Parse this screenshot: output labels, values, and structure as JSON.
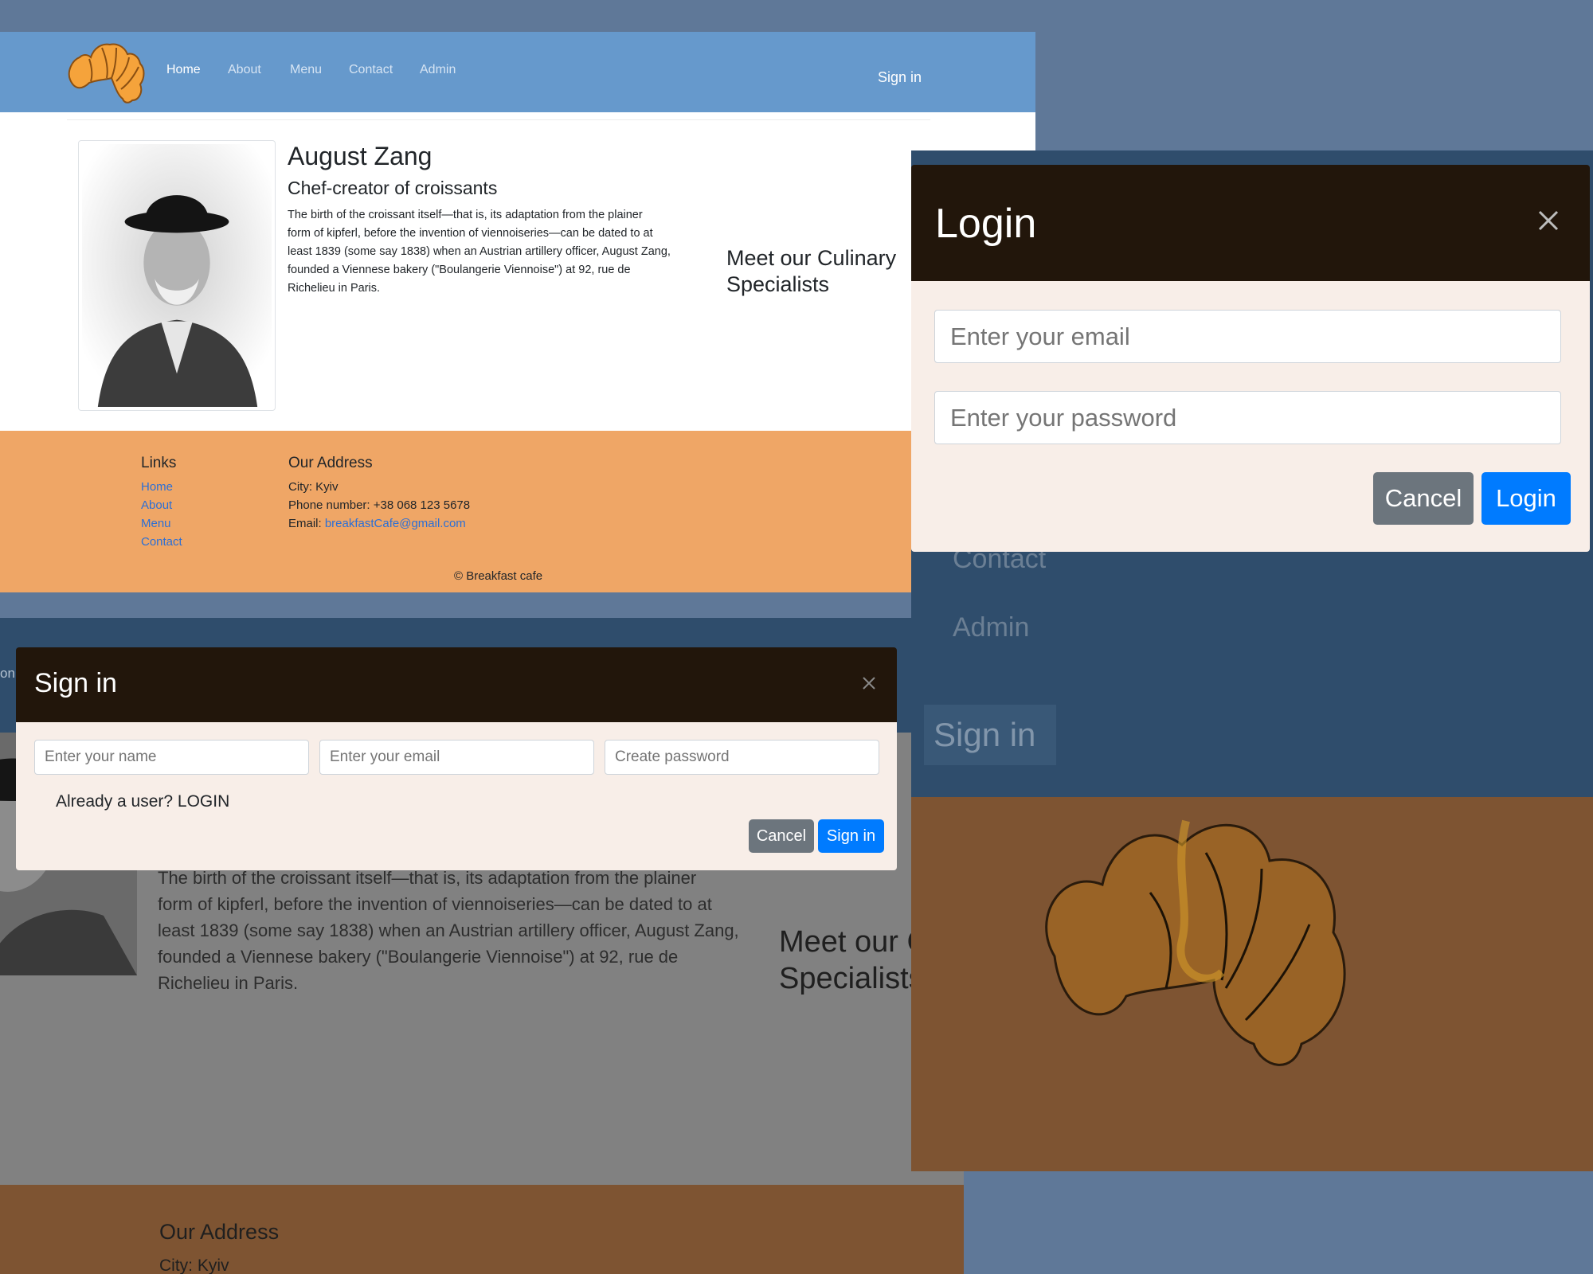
{
  "site": {
    "nav": {
      "logo_icon": "croissant-logo-icon",
      "links": [
        "Home",
        "About",
        "Menu",
        "Contact",
        "Admin"
      ],
      "active": "Home",
      "signin": "Sign in"
    },
    "chef": {
      "name": "August Zang",
      "role": "Chef-creator of croissants",
      "bio_lines": [
        "The birth of the croissant itself—that is, its adaptation from the plainer",
        "form of kipferl, before the invention of viennoiseries—can be dated to at",
        "least 1839 (some say 1838) when an Austrian artillery officer, August Zang,",
        "founded a Viennese bakery (\"Boulangerie Viennoise\") at 92, rue de",
        "Richelieu in Paris."
      ]
    },
    "specialists_lines": [
      "Meet our Culinary",
      "Specialists"
    ],
    "footer": {
      "links_heading": "Links",
      "links": [
        "Home",
        "About",
        "Menu",
        "Contact"
      ],
      "address_heading": "Our Address",
      "city": "City: Kyiv",
      "phone": "Phone number: +38 068 123 5678",
      "email_label": "Email: ",
      "email": "breakfastCafe@gmail.com",
      "copyright": "© Breakfast cafe"
    }
  },
  "signin_modal": {
    "title": "Sign in",
    "close_icon": "close-icon",
    "name_placeholder": "Enter your name",
    "email_placeholder": "Enter your email",
    "password_placeholder": "Create password",
    "already_user": "Already a user? LOGIN",
    "cancel": "Cancel",
    "submit": "Sign in"
  },
  "login_modal": {
    "title": "Login",
    "close_icon": "close-icon",
    "email_placeholder": "Enter your email",
    "password_placeholder": "Enter your password",
    "cancel": "Cancel",
    "submit": "Login"
  },
  "background_page": {
    "partial_text": "on",
    "menu_links": [
      "Contact",
      "Admin"
    ],
    "signin": "Sign in"
  },
  "colors": {
    "navbar": "#6699cc",
    "footer": "#efa666",
    "modal_header": "#22160b",
    "modal_body": "#f8eee8",
    "primary_button": "#007bff",
    "secondary_button": "#6c757d"
  }
}
